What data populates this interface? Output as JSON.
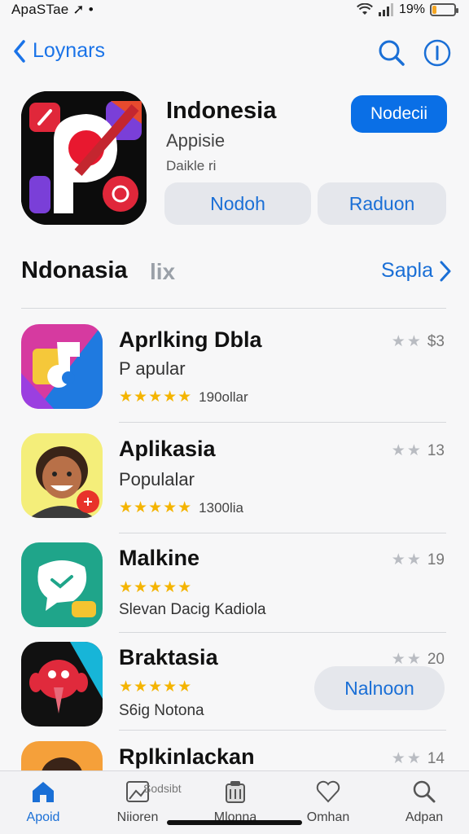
{
  "status_bar": {
    "carrier": "ApaSTae",
    "battery": "19%",
    "battery_level": 0.19
  },
  "nav": {
    "back_label": "Loynars"
  },
  "featured": {
    "title": "Indonesia",
    "subtitle": "Appisie",
    "detail": "Daikle ri",
    "get_label": "Nodecii",
    "action_left": "Nodoh",
    "action_right": "Raduon"
  },
  "section": {
    "title": "Ndonasia",
    "badge": "lix",
    "see_all": "Sapla"
  },
  "apps": [
    {
      "name": "Aprlking Dbla",
      "sub": "P apular",
      "rating_stars": "★★★★★",
      "rating_text": "190ollar",
      "meta": "$3"
    },
    {
      "name": "Aplikasia",
      "sub": "Populalar",
      "rating_stars": "★★★★★",
      "rating_text": "1300lia",
      "meta": "13"
    },
    {
      "name": "Malkine",
      "rating_stars": "★★★★★",
      "small": "Slevan Dacig Kadiola",
      "meta": "19"
    },
    {
      "name": "Braktasia",
      "rating_stars": "★★★★★",
      "small": "S6ig Notona",
      "meta": "20",
      "button": "Nalnoon"
    },
    {
      "name": "Rplkinlackan",
      "meta": "14"
    }
  ],
  "tabbar": {
    "overlay_text": "Sodsibt",
    "tabs": [
      {
        "label": "Apoid"
      },
      {
        "label": "Niioren"
      },
      {
        "label": "Mlonna"
      },
      {
        "label": "Omhan"
      },
      {
        "label": "Adpan"
      }
    ]
  },
  "colors": {
    "accent": "#0a6fe6",
    "link": "#1a6fd6",
    "star": "#f4b400",
    "battery": "#f5a623"
  }
}
